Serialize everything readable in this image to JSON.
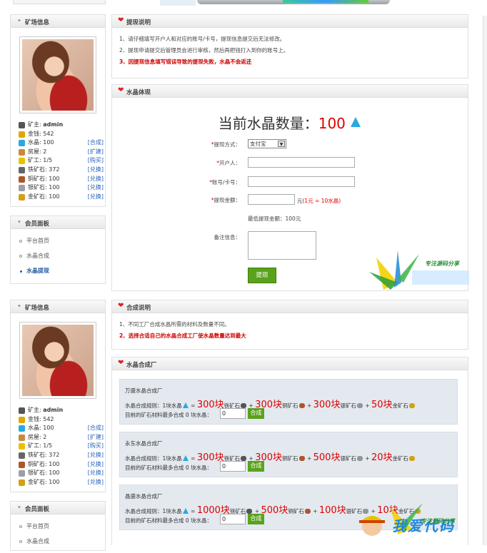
{
  "page": {
    "title": "水晶提现"
  },
  "sidebar_top": {
    "mine_info": {
      "title": "矿场信息",
      "stats": [
        {
          "label": "矿主:",
          "value": "admin",
          "link": ""
        },
        {
          "label": "金钱:",
          "value": "542",
          "link": ""
        },
        {
          "label": "水晶:",
          "value": "100",
          "link": "[合成]"
        },
        {
          "label": "房屋:",
          "value": "2",
          "link": "[扩建]"
        },
        {
          "label": "矿工:",
          "value": "1/5",
          "link": "[购买]"
        },
        {
          "label": "铁矿石:",
          "value": "372",
          "link": "[兑换]"
        },
        {
          "label": "铜矿石:",
          "value": "100",
          "link": "[兑换]"
        },
        {
          "label": "银矿石:",
          "value": "100",
          "link": "[兑换]"
        },
        {
          "label": "金矿石:",
          "value": "100",
          "link": "[兑换]"
        }
      ]
    },
    "member_panel": {
      "title": "会员面板",
      "items": [
        "平台首页",
        "水晶合成",
        "水晶提现"
      ]
    }
  },
  "withdraw_info": {
    "title": "提现说明",
    "line1": "1、请仔细填写开户人和对应的账号/卡号，提现信息提交后无法修改。",
    "line2": "2、提现申请提交后管理员会进行审核，然后再把钱打入到你的账号上。",
    "line3": "3、因提现信息填写错误导致的提现失败，水晶不会返还"
  },
  "withdraw_form": {
    "title": "水晶体现",
    "big_label": "当前水晶数量：",
    "big_value": "100",
    "method_label": "提现方式：",
    "method_value": "支付宝",
    "holder_label": "开户人：",
    "account_label": "账号/卡号：",
    "amount_label": "提现金额：",
    "amount_unit": "元",
    "amount_rate": "(1元 = 10水晶)",
    "min_note": "最低提现金额：100元",
    "remark_label": "备注信息：",
    "submit_label": "提现",
    "required_mark": "*"
  },
  "sidebar_bottom": {
    "mine_info": {
      "title": "矿场信息",
      "stats": [
        {
          "label": "矿主:",
          "value": "admin",
          "link": ""
        },
        {
          "label": "金钱:",
          "value": "542",
          "link": ""
        },
        {
          "label": "水晶:",
          "value": "100",
          "link": "[合成]"
        },
        {
          "label": "房屋:",
          "value": "2",
          "link": "[扩建]"
        },
        {
          "label": "矿工:",
          "value": "1/5",
          "link": "[购买]"
        },
        {
          "label": "铁矿石:",
          "value": "372",
          "link": "[兑换]"
        },
        {
          "label": "铜矿石:",
          "value": "100",
          "link": "[兑换]"
        },
        {
          "label": "银矿石:",
          "value": "100",
          "link": "[兑换]"
        },
        {
          "label": "金矿石:",
          "value": "100",
          "link": "[兑换]"
        }
      ]
    },
    "member_panel": {
      "title": "会员面板",
      "items": [
        "平台首页",
        "水晶合成"
      ]
    }
  },
  "compose_info": {
    "title": "合成说明",
    "line1": "1、不同工厂合成水晶所需的材料及数量不同。",
    "line2": "2、选择合适自己的水晶合成工厂使水晶数量达到最大"
  },
  "factories": {
    "title": "水晶合成厂",
    "rule_prefix": "水晶合成规则：1块水晶",
    "max_prefix": "目前的矿石材料最多合成",
    "max_suffix": "块水晶：",
    "compose_label": "合成",
    "list": [
      {
        "name": "万盛水晶合成厂",
        "a": "300块",
        "b": "300块",
        "c": "300块",
        "d": "50块",
        "max": "0",
        "qty": "0"
      },
      {
        "name": "永东水晶合成厂",
        "a": "300块",
        "b": "300块",
        "c": "500块",
        "d": "20块",
        "max": "0",
        "qty": "0"
      },
      {
        "name": "晶盛水晶合成厂",
        "a": "1000块",
        "b": "500块",
        "c": "100块",
        "d": "10块",
        "max": "0",
        "qty": "0"
      }
    ],
    "ore_names": {
      "iron": "铁矿石",
      "copper": "铜矿石",
      "silver": "银矿石",
      "gold": "金矿石"
    }
  },
  "watermarks": {
    "top": "专注源码分享",
    "bottom": "专注源码分享",
    "logo": "我爱代码"
  },
  "colors": {
    "accent_red": "#d00000",
    "button_green": "#5aa21b",
    "link_blue": "#2a63b8",
    "panel_bg": "#e3e9ef"
  }
}
